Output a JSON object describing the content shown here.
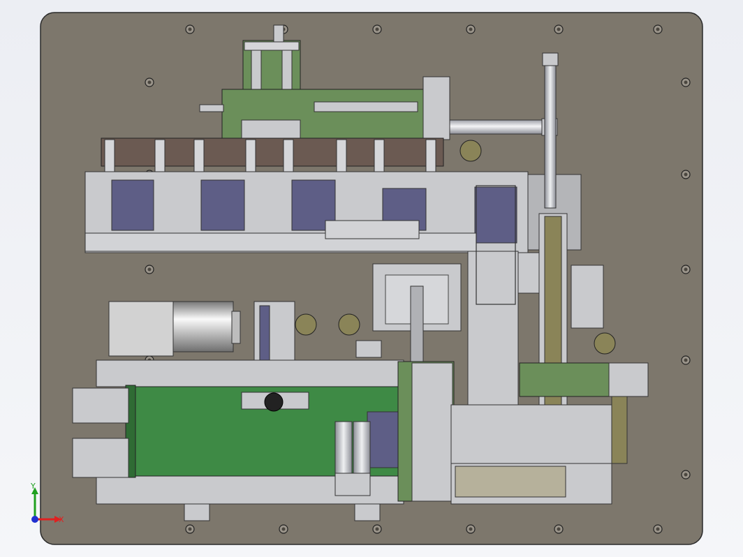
{
  "viewport": {
    "background_color": "#eef0f4",
    "base_plate_color": "#7d776c",
    "conveyor_belt_color": "#3e8a45",
    "frame_steel_color": "#c9cacd",
    "slide_green_color": "#6b8f5a",
    "bracket_brown_color": "#6b5a52",
    "window_blue_color": "#5e5e86",
    "motor_silver_color": "#dcdcdc",
    "roller_disc_color": "#8a8458"
  },
  "triad": {
    "x_label": "X",
    "y_label": "Y",
    "x_color": "#e02020",
    "y_color": "#20a020",
    "origin_color": "#2030d0"
  }
}
